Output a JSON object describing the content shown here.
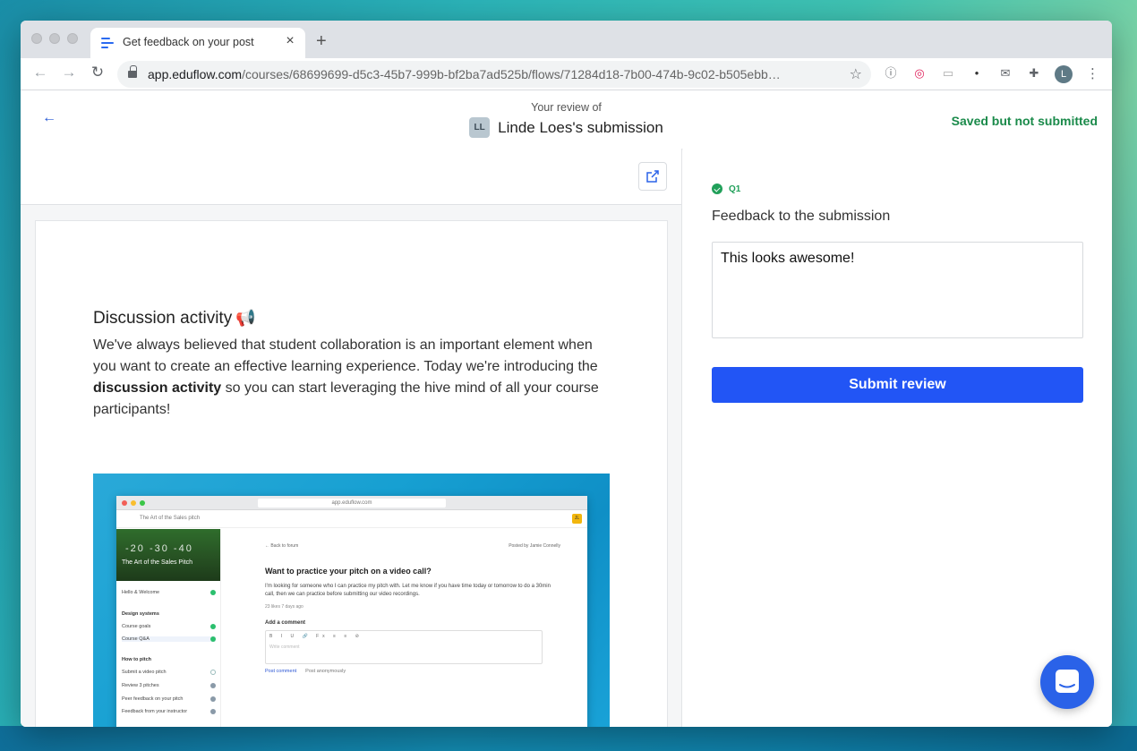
{
  "browser": {
    "tab_title": "Get feedback on your post",
    "url_host": "app.eduflow.com",
    "url_path": "/courses/68699699-d5c3-45b7-999b-bf2ba7ad525b/flows/71284d18-7b00-474b-9c02-b505ebb…",
    "profile_initial": "L"
  },
  "header": {
    "review_of": "Your review of",
    "submitter_initials": "LL",
    "submission_title": "Linde Loes's submission",
    "status": "Saved but not submitted"
  },
  "document": {
    "heading": "Discussion activity",
    "heading_emoji": "📢",
    "body_before": "We've always believed that student collaboration is an important element when you want to create an effective learning experience. Today we're introducing the ",
    "body_bold": "discussion activity",
    "body_after": " so you can start leveraging the hive mind of all your course participants!",
    "screenshot": {
      "url": "app.eduflow.com",
      "breadcrumb": "The Art of the Sales pitch",
      "user_initials": "JL",
      "cover_numbers": "-20 -30 -40",
      "cover_title": "The Art of the Sales Pitch",
      "items": [
        "Hello & Welcome",
        "Course goals",
        "Course Q&A",
        "Submit a video pitch",
        "Review 3 pitches",
        "Peer feedback on your pitch",
        "Feedback from your instructor"
      ],
      "sections": [
        "Design systems",
        "How to pitch"
      ],
      "back": "← Back to forum",
      "posted_by": "Posted by  Jamie Connelly",
      "question": "Want to practice your pitch on a video call?",
      "description": "I'm looking for someone who I can practice my pitch with. Let me know if you have time today or tomorrow to do a 30min call, then we can practice before submitting our video recordings.",
      "meta": "23 likes   7 days ago",
      "add_comment": "Add a comment",
      "editor_toolbar": "B I U 🔗 Fx ≡ ≡ ⊘",
      "editor_placeholder": "Write comment",
      "post_comment": "Post comment",
      "post_anon": "Post anonymously"
    }
  },
  "review": {
    "question_label": "Q1",
    "question_prompt": "Feedback to the submission",
    "answer": "This looks awesome!",
    "submit_label": "Submit review"
  }
}
